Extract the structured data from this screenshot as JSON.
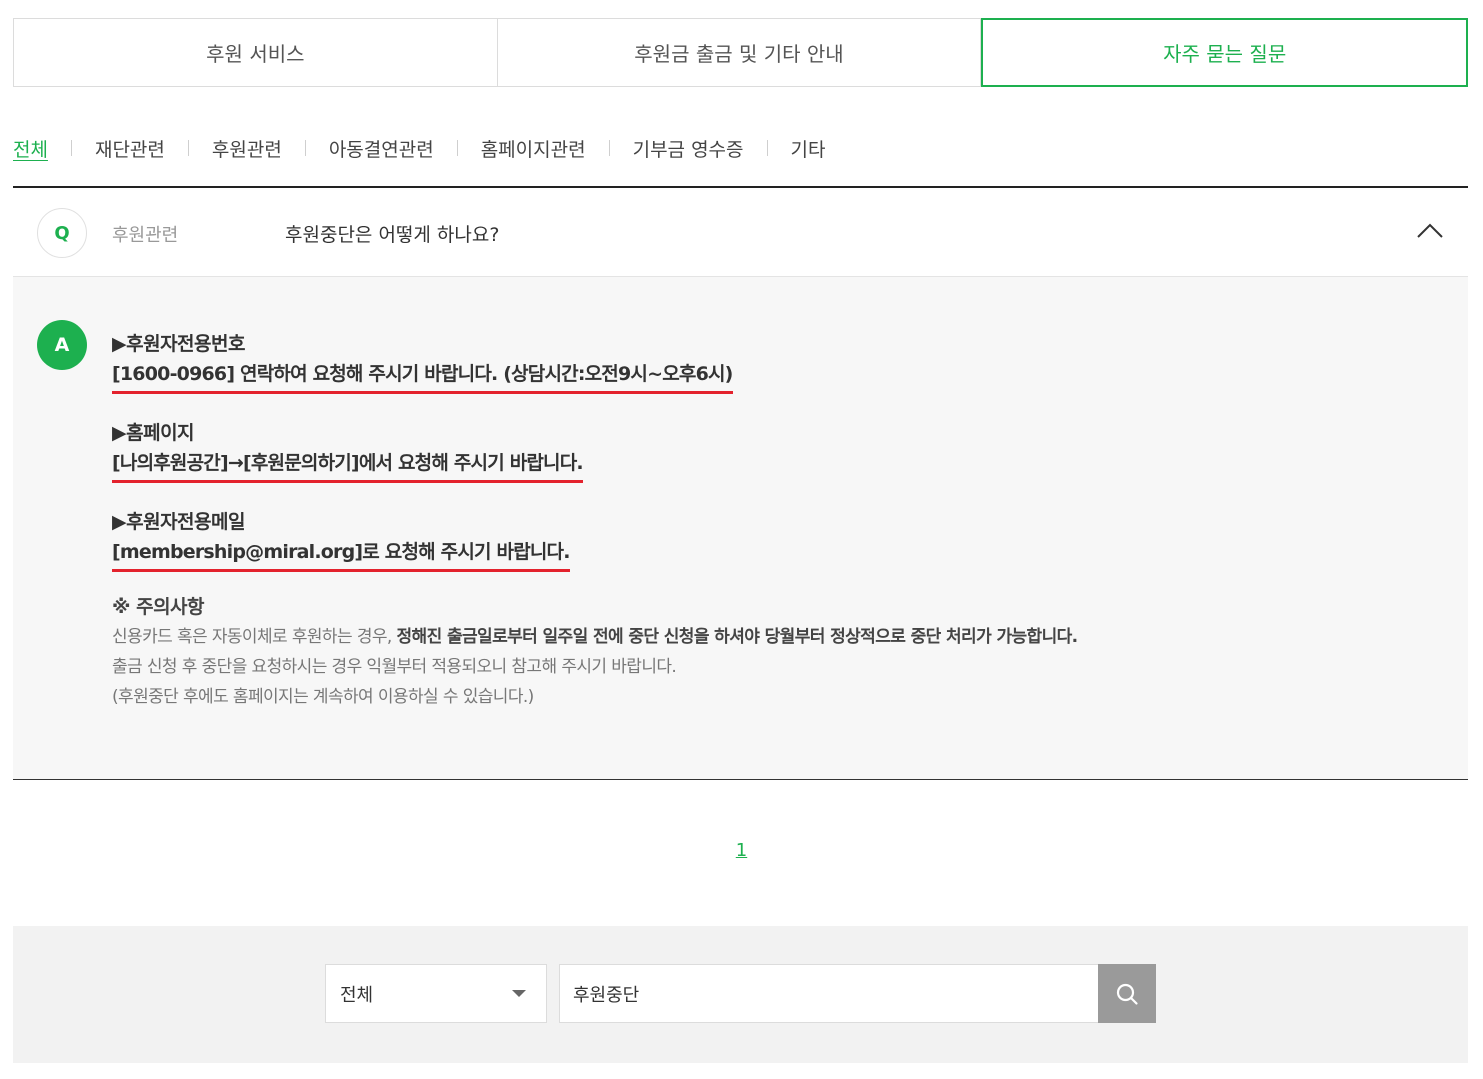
{
  "top_tabs": [
    {
      "label": "후원 서비스"
    },
    {
      "label": "후원금 출금 및 기타 안내"
    },
    {
      "label": "자주 묻는 질문"
    }
  ],
  "categories": [
    {
      "label": "전체"
    },
    {
      "label": "재단관련"
    },
    {
      "label": "후원관련"
    },
    {
      "label": "아동결연관련"
    },
    {
      "label": "홈페이지관련"
    },
    {
      "label": "기부금 영수증"
    },
    {
      "label": "기타"
    }
  ],
  "faq": {
    "q_badge": "Q",
    "category": "후원관련",
    "question": "후원중단은 어떻게 하나요?",
    "a_badge": "A",
    "blocks": [
      {
        "heading": "▶후원자전용번호",
        "line": "[1600-0966] 연락하여 요청해 주시기 바랍니다. (상담시간:오전9시~오후6시)"
      },
      {
        "heading": "▶홈페이지",
        "line": "[나의후원공간]→[후원문의하기]에서 요청해 주시기 바랍니다."
      },
      {
        "heading": "▶후원자전용메일",
        "line": "[membership@miral.org]로 요청해 주시기 바랍니다."
      }
    ],
    "note": {
      "heading": "※ 주의사항",
      "line1_plain": "신용카드 혹은 자동이체로 후원하는 경우, ",
      "line1_bold": "정해진 출금일로부터 일주일 전에 중단 신청을 하셔야 당월부터 정상적으로 중단 처리가 가능합니다.",
      "line2": "출금 신청 후 중단을 요청하시는 경우 익월부터 적용되오니 참고해 주시기 바랍니다.",
      "line3": "(후원중단 후에도 홈페이지는 계속하여 이용하실 수 있습니다.)"
    }
  },
  "pagination": {
    "current": "1"
  },
  "search": {
    "select_value": "전체",
    "input_value": "후원중단"
  },
  "colors": {
    "accent": "#1db04f",
    "underline": "#e3222d"
  }
}
